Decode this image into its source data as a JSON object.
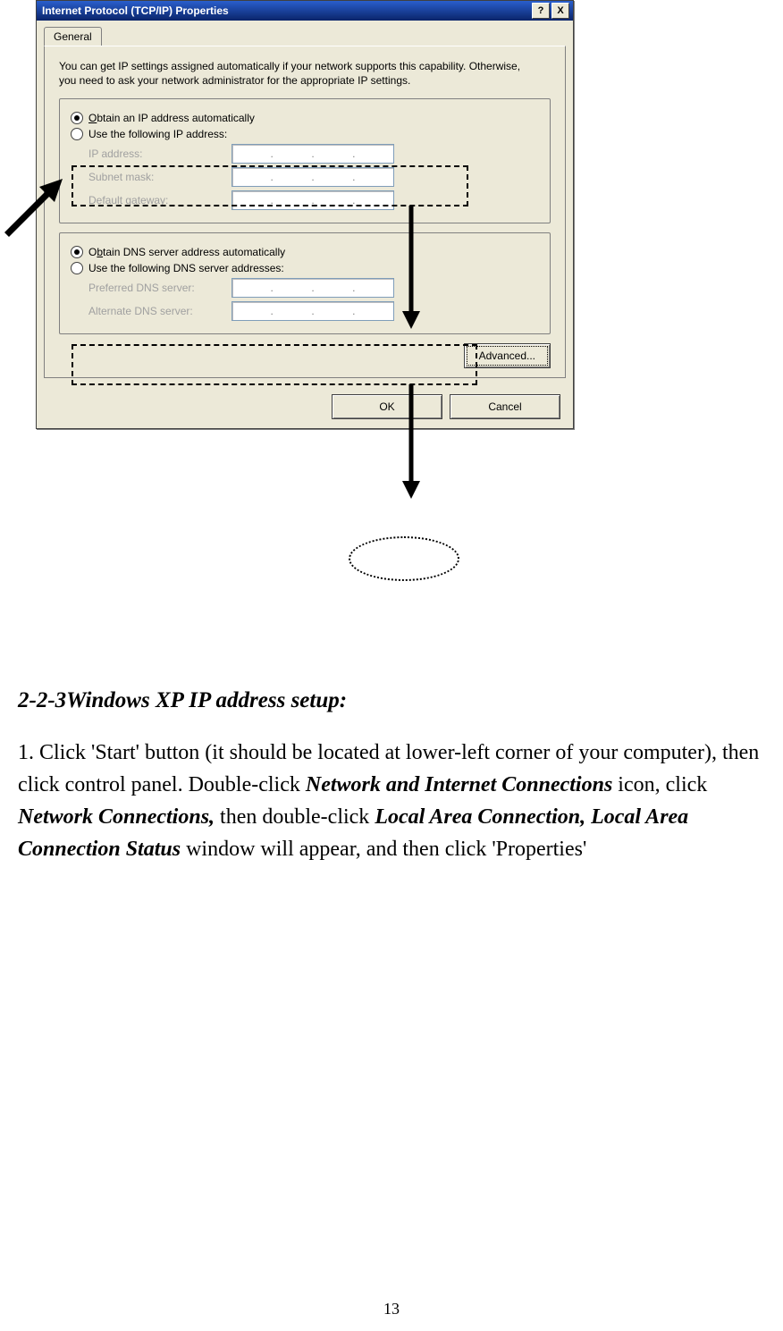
{
  "dialog": {
    "title": "Internet Protocol (TCP/IP) Properties",
    "help_btn": "?",
    "close_btn": "X",
    "tab": "General",
    "intro": "You can get IP settings assigned automatically if your network supports this capability. Otherwise, you need to ask your network administrator for the appropriate IP settings.",
    "ip_group": {
      "auto": "Obtain an IP address automatically",
      "manual": "Use the following IP address:",
      "fields": {
        "ip": "IP address:",
        "subnet": "Subnet mask:",
        "gateway": "Default gateway:"
      }
    },
    "dns_group": {
      "auto": "Obtain DNS server address automatically",
      "manual": "Use the following DNS server addresses:",
      "fields": {
        "preferred": "Preferred DNS server:",
        "alternate": "Alternate DNS server:"
      }
    },
    "advanced_btn": "Advanced...",
    "ok_btn": "OK",
    "cancel_btn": "Cancel"
  },
  "doc": {
    "heading": "2-2-3Windows XP IP address setup:",
    "step_prefix": "1. Click 'Start' button (it should be located at lower-left corner of your computer), then click control panel. Double-click ",
    "nic": "Network and Internet Connections",
    "mid1": " icon, click ",
    "nc": "Network Connections,",
    "mid2": " then double-click ",
    "lac": "Local Area Connection, Local Area Connection Status",
    "tail": " window will appear, and then click 'Properties'"
  },
  "page_number": "13"
}
